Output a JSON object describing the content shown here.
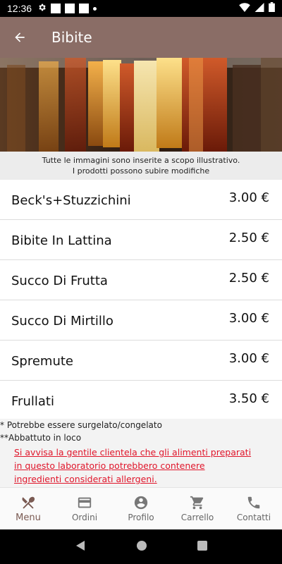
{
  "status_bar": {
    "time": "12:36"
  },
  "header": {
    "title": "Bibite"
  },
  "notice": {
    "line1": "Tutte le immagini sono inserite a scopo illustrativo.",
    "line2": "I prodotti possono subire modifiche"
  },
  "items": [
    {
      "name": "Beck's+Stuzzichini",
      "price": "3.00 €"
    },
    {
      "name": "Bibite In Lattina",
      "price": "2.50 €"
    },
    {
      "name": "Succo Di Frutta",
      "price": "2.50 €"
    },
    {
      "name": "Succo Di Mirtillo",
      "price": "3.00 €"
    },
    {
      "name": "Spremute",
      "price": "3.00 €"
    },
    {
      "name": "Frullati",
      "price": "3.50 €"
    }
  ],
  "footer_notes": {
    "note1": "* Potrebbe essere surgelato/congelato",
    "note2": "**Abbattuto in loco",
    "warning": "Si avvisa la gentile clientela che gli alimenti preparati in questo laboratorio potrebbero contenere ingredienti considerati allergeni."
  },
  "bottom_nav": [
    {
      "label": "Menu",
      "icon": "cutlery-icon",
      "active": true
    },
    {
      "label": "Ordini",
      "icon": "card-icon",
      "active": false
    },
    {
      "label": "Profilo",
      "icon": "account-icon",
      "active": false
    },
    {
      "label": "Carrello",
      "icon": "cart-icon",
      "active": false
    },
    {
      "label": "Contatti",
      "icon": "phone-icon",
      "active": false
    }
  ],
  "colors": {
    "app_bar": "#8a6d66",
    "active_nav": "#7a5a52",
    "warning": "#e0162b"
  }
}
